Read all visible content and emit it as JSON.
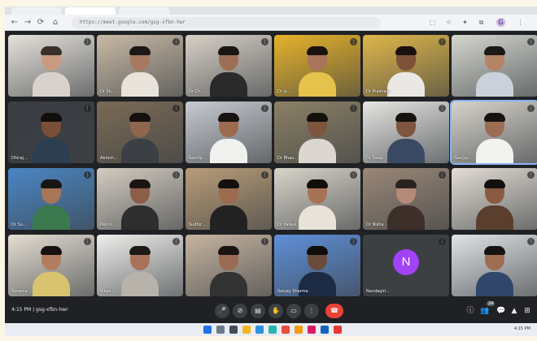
{
  "browser": {
    "url": "https://meet.google.com/gsg-xfbn-hwr",
    "nav": {
      "back": "←",
      "forward": "→",
      "reload": "⟳",
      "home": "⌂"
    },
    "profile_initial": "G"
  },
  "participants": [
    {
      "name": "",
      "skin": "#c99a82",
      "shirt": "#d9d2cc",
      "bg": "#e6e2dc",
      "hair": "#3b2f2a"
    },
    {
      "name": "Dr Sh...",
      "skin": "#a87860",
      "shirt": "#e8e4dc",
      "bg": "#c8b9a5",
      "hair": "#1c1816"
    },
    {
      "name": "Dr Ch...",
      "skin": "#9e6f57",
      "shirt": "#2a2a2a",
      "bg": "#d7d0c6",
      "hair": "#1a1614"
    },
    {
      "name": "Dr Jy...",
      "skin": "#a8745a",
      "shirt": "#e5c24b",
      "bg": "#e6b22a",
      "hair": "#19130f"
    },
    {
      "name": "Dr Prashant",
      "skin": "#7e5238",
      "shirt": "#e9e8e4",
      "bg": "#e0b64a",
      "hair": "#171210"
    },
    {
      "name": "",
      "skin": "#b58366",
      "shirt": "#cbd1d8",
      "bg": "#d4d6cf",
      "hair": "#1d1917"
    },
    {
      "name": "Dhiraj...",
      "skin": "#7a4f38",
      "shirt": "#2c3e50",
      "bg": "#3a3d42",
      "hair": "#120e0c"
    },
    {
      "name": "Abhish...",
      "skin": "#8f6650",
      "shirt": "#3b3f44",
      "bg": "#7a6a55",
      "hair": "#151110"
    },
    {
      "name": "Sandip...",
      "skin": "#9b6a4f",
      "shirt": "#f0f0ee",
      "bg": "#c7cad0",
      "hair": "#161210"
    },
    {
      "name": "Dr Bhau...",
      "skin": "#7d5640",
      "shirt": "#dbd6d0",
      "bg": "#8c8066",
      "hair": "#130f0d"
    },
    {
      "name": "Dr Swap...",
      "skin": "#7d5540",
      "shirt": "#3b4a63",
      "bg": "#e5e5e2",
      "hair": "#161210"
    },
    {
      "name": "Sanjay...",
      "skin": "#9b6d54",
      "shirt": "#f2f2ef",
      "bg": "#d6d3cb",
      "hair": "#171311"
    },
    {
      "name": "Dr Su...",
      "skin": "#a87557",
      "shirt": "#3b7a4e",
      "bg": "#4a86c4",
      "hair": "#1a1513"
    },
    {
      "name": "Nikhil...",
      "skin": "#8a5e47",
      "shirt": "#2e2e2e",
      "bg": "#d3cbc0",
      "hair": "#1a1513"
    },
    {
      "name": "Sudhir...",
      "skin": "#9c6a4e",
      "shirt": "#222222",
      "bg": "#b89c78",
      "hair": "#141010"
    },
    {
      "name": "Dr Pallavi...",
      "skin": "#a77356",
      "shirt": "#e9e3da",
      "bg": "#d9d4ca",
      "hair": "#120e0c"
    },
    {
      "name": "Dr Nisha",
      "skin": "#b48b78",
      "shirt": "#3d2f2a",
      "bg": "#9a8777",
      "hair": "#2a2220"
    },
    {
      "name": "",
      "skin": "#8a5b40",
      "shirt": "#5a3f2e",
      "bg": "#e3ddd4",
      "hair": "#141010"
    },
    {
      "name": "Swapna...",
      "skin": "#b27c5f",
      "shirt": "#d8c46e",
      "bg": "#e4ddd2",
      "hair": "#161210"
    },
    {
      "name": "Vikas...",
      "skin": "#a87358",
      "shirt": "#b7b2aa",
      "bg": "#efefec",
      "hair": "#1d1917"
    },
    {
      "name": "",
      "skin": "#9a6a52",
      "shirt": "#333333",
      "bg": "#c6b4a0",
      "hair": "#1a1513"
    },
    {
      "name": "Sanjay Sharma",
      "skin": "#6b4c3c",
      "shirt": "#1c2a44",
      "bg": "#5e8fd8",
      "hair": "#0f0c0a"
    },
    {
      "name": "Nandagiri...",
      "avatar": "N"
    },
    {
      "name": "",
      "skin": "#9e6d52",
      "shirt": "#30476b",
      "bg": "#dfe3e6",
      "hair": "#161210"
    }
  ],
  "meetbar": {
    "time_code": "4:15 PM | gsg-xfbn-hwr",
    "controls": [
      "🎤",
      "⊘",
      "▤",
      "✋",
      "▭",
      "⋮"
    ],
    "end_call": "☎",
    "side_icons": [
      "ⓘ",
      "👥",
      "💬",
      "▲",
      "⊞"
    ],
    "people_count": "24"
  },
  "taskbar": {
    "clock": "4:15 PM"
  },
  "colors": {
    "meet_dark": "#202124",
    "tile": "#3c4043",
    "end_red": "#ea4335",
    "avatar_purple": "#a142f4",
    "active_blue": "#8ab4f8"
  }
}
